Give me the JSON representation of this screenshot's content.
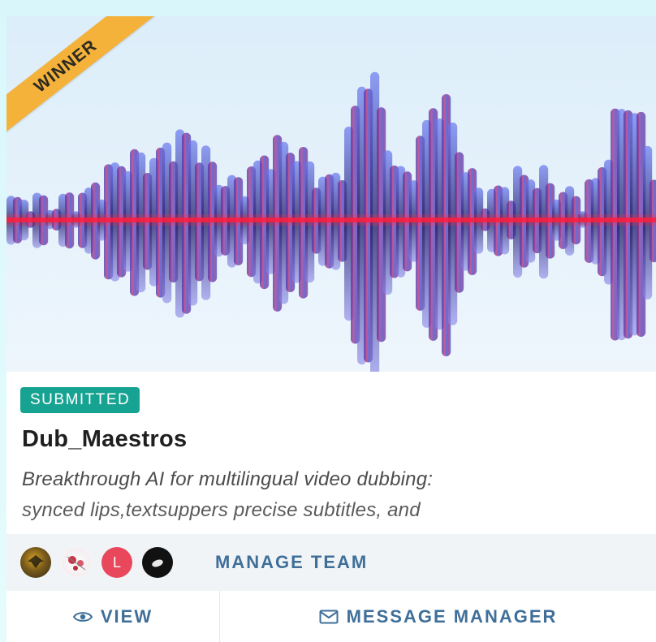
{
  "card": {
    "ribbon": "WINNER",
    "status": "SUBMITTED",
    "title": "Dub_Maestros",
    "description_line1": "Breakthrough AI for multilingual video dubbing:",
    "description_line2": "synced lips,textsuppers precise subtitles, and"
  },
  "team": {
    "avatars": [
      {
        "icon": "team-avatar-gold"
      },
      {
        "icon": "team-avatar-flower"
      },
      {
        "letter": "L",
        "color": "#e8475c"
      },
      {
        "icon": "team-avatar-dark"
      }
    ],
    "manage_label": "MANAGE TEAM"
  },
  "actions": {
    "view_label": "VIEW",
    "message_label": "MESSAGE MANAGER"
  },
  "colors": {
    "accent": "#3f6f99",
    "status": "#17a392",
    "ribbon": "#f4b23b"
  }
}
